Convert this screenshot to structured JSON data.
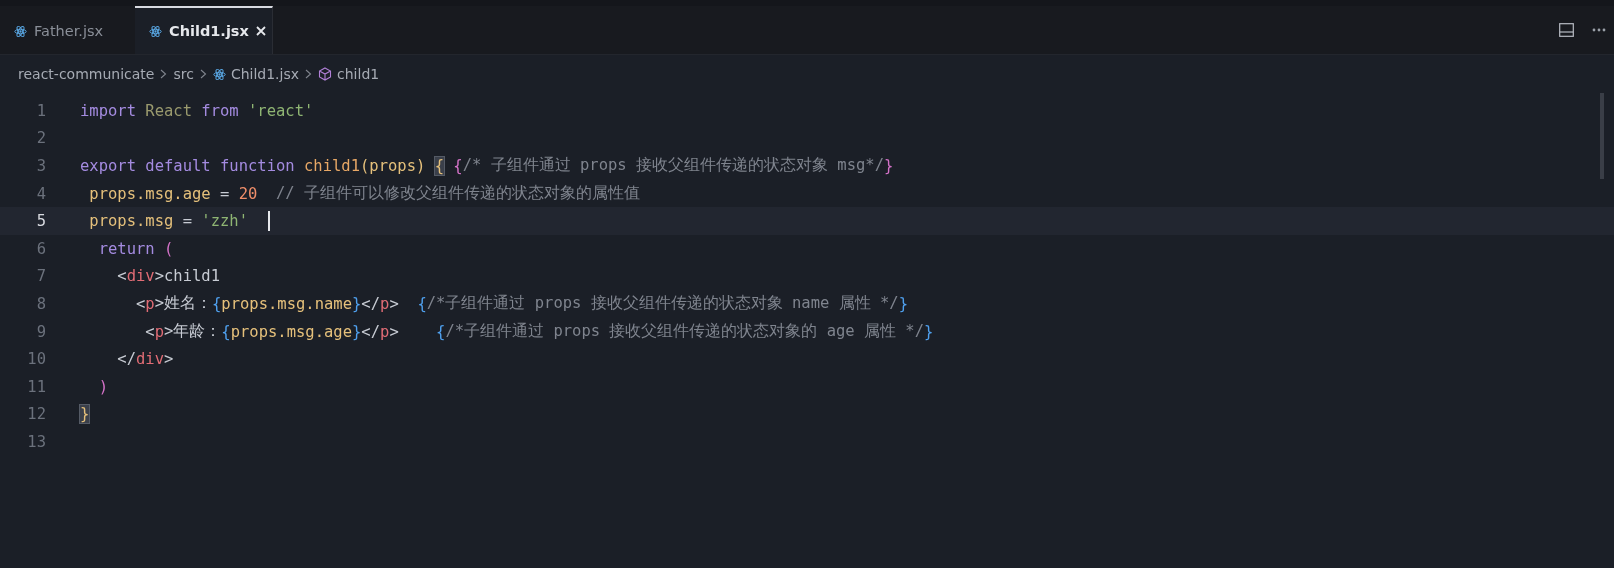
{
  "tabs": [
    {
      "label": "Father.jsx",
      "selected": false
    },
    {
      "label": "Child1.jsx",
      "selected": true
    }
  ],
  "breadcrumb": [
    {
      "label": "react-communicate",
      "kind": "folder"
    },
    {
      "label": "src",
      "kind": "folder"
    },
    {
      "label": "Child1.jsx",
      "kind": "file"
    },
    {
      "label": "child1",
      "kind": "symbol"
    }
  ],
  "editor": {
    "lines": [
      {
        "number": "1",
        "current": false,
        "tokens": [
          {
            "text": "import",
            "kind": "keyword"
          },
          {
            "text": " React",
            "kind": "class"
          },
          {
            "text": " from",
            "kind": "keyword"
          },
          {
            "text": " 'react'",
            "kind": "string"
          }
        ]
      },
      {
        "number": "2",
        "current": false
      },
      {
        "number": "3",
        "current": false,
        "tokens": [
          {
            "text": "export",
            "kind": "keyword"
          },
          {
            "text": " default",
            "kind": "keyword"
          },
          {
            "text": " function",
            "kind": "keyword"
          },
          {
            "text": " child1",
            "kind": "fn"
          },
          {
            "text": "(",
            "kind": "brace1"
          },
          {
            "text": "props",
            "kind": "param"
          },
          {
            "text": ") ",
            "kind": "brace1"
          },
          {
            "text": "{",
            "kind": "match"
          },
          {
            "text": " {",
            "kind": "brace2"
          },
          {
            "text": "/* 子组件通过 props 接收父组件传递的状态对象 msg*/",
            "kind": "comment"
          },
          {
            "text": "}",
            "kind": "brace2"
          }
        ]
      },
      {
        "number": "4",
        "current": false,
        "tokens": [
          {
            "text": " props.msg.age",
            "kind": "var"
          },
          {
            "text": " =",
            "kind": "plain"
          },
          {
            "text": " 20",
            "kind": "number"
          },
          {
            "text": "  // 子组件可以修改父组件传递的状态对象的属性值",
            "kind": "comment"
          }
        ]
      },
      {
        "number": "5",
        "current": true,
        "tokens": [
          {
            "text": " props.msg",
            "kind": "var"
          },
          {
            "text": " =",
            "kind": "plain"
          },
          {
            "text": " 'zzh'",
            "kind": "string"
          }
        ]
      },
      {
        "number": "6",
        "current": false,
        "tokens": [
          {
            "text": "  return",
            "kind": "keyword"
          },
          {
            "text": " (",
            "kind": "brace2"
          }
        ]
      },
      {
        "number": "7",
        "current": false,
        "tokens": [
          {
            "text": "    <",
            "kind": "plain"
          },
          {
            "text": "div",
            "kind": "tag"
          },
          {
            "text": ">child1",
            "kind": "plain"
          }
        ]
      },
      {
        "number": "8",
        "current": false,
        "tokens": [
          {
            "text": "      <",
            "kind": "plain"
          },
          {
            "text": "p",
            "kind": "tag"
          },
          {
            "text": ">姓名：",
            "kind": "plain"
          },
          {
            "text": "{",
            "kind": "brace3"
          },
          {
            "text": "props.msg.name",
            "kind": "var"
          },
          {
            "text": "}",
            "kind": "brace3"
          },
          {
            "text": "</",
            "kind": "plain"
          },
          {
            "text": "p",
            "kind": "tag"
          },
          {
            "text": ">",
            "kind": "plain"
          },
          {
            "text": "  {",
            "kind": "brace3"
          },
          {
            "text": "/*子组件通过 props 接收父组件传递的状态对象 name 属性 */",
            "kind": "comment"
          },
          {
            "text": "}",
            "kind": "brace3"
          }
        ]
      },
      {
        "number": "9",
        "current": false,
        "tokens": [
          {
            "text": "       <",
            "kind": "plain"
          },
          {
            "text": "p",
            "kind": "tag"
          },
          {
            "text": ">年龄：",
            "kind": "plain"
          },
          {
            "text": "{",
            "kind": "brace3"
          },
          {
            "text": "props.msg.age",
            "kind": "var"
          },
          {
            "text": "}",
            "kind": "brace3"
          },
          {
            "text": "</",
            "kind": "plain"
          },
          {
            "text": "p",
            "kind": "tag"
          },
          {
            "text": ">",
            "kind": "plain"
          },
          {
            "text": "    {",
            "kind": "brace3"
          },
          {
            "text": "/*子组件通过 props 接收父组件传递的状态对象的 age 属性 */",
            "kind": "comment"
          },
          {
            "text": "}",
            "kind": "brace3"
          }
        ]
      },
      {
        "number": "10",
        "current": false,
        "tokens": [
          {
            "text": "    </",
            "kind": "plain"
          },
          {
            "text": "div",
            "kind": "tag"
          },
          {
            "text": ">",
            "kind": "plain"
          }
        ]
      },
      {
        "number": "11",
        "current": false,
        "tokens": [
          {
            "text": "  )",
            "kind": "brace2"
          }
        ]
      },
      {
        "number": "12",
        "current": false,
        "tokens": [
          {
            "text": "}",
            "kind": "match"
          }
        ]
      },
      {
        "number": "13",
        "current": false
      }
    ]
  }
}
